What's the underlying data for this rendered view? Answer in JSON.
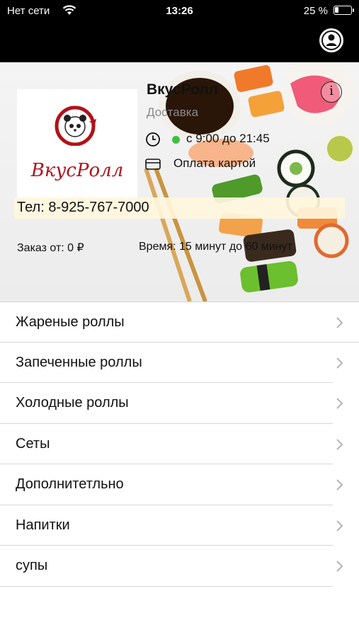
{
  "status_bar": {
    "carrier": "Нет сети",
    "time": "13:26",
    "battery_text": "25 %",
    "battery_level": 0.25
  },
  "header": {
    "profile_icon": "profile-icon"
  },
  "restaurant": {
    "logo_text": "ВкусРолл",
    "name": "ВкусРолл",
    "subtitle": "Доставка",
    "info_icon": "info-icon",
    "hours": "с 9:00 до 21:45",
    "open_status_color": "#3fbf3f",
    "payment": "Оплата картой",
    "phone": "Тел: 8-925-767-7000",
    "min_order": "Заказ от: 0 ₽",
    "delivery_time": "Время: 15 минут до 60 минут"
  },
  "menu": {
    "items": [
      {
        "label": "Жареные роллы"
      },
      {
        "label": "Запеченные роллы"
      },
      {
        "label": "Холодные роллы"
      },
      {
        "label": "Сеты"
      },
      {
        "label": "Дополнитетльно"
      },
      {
        "label": "Напитки"
      },
      {
        "label": "супы"
      }
    ]
  }
}
